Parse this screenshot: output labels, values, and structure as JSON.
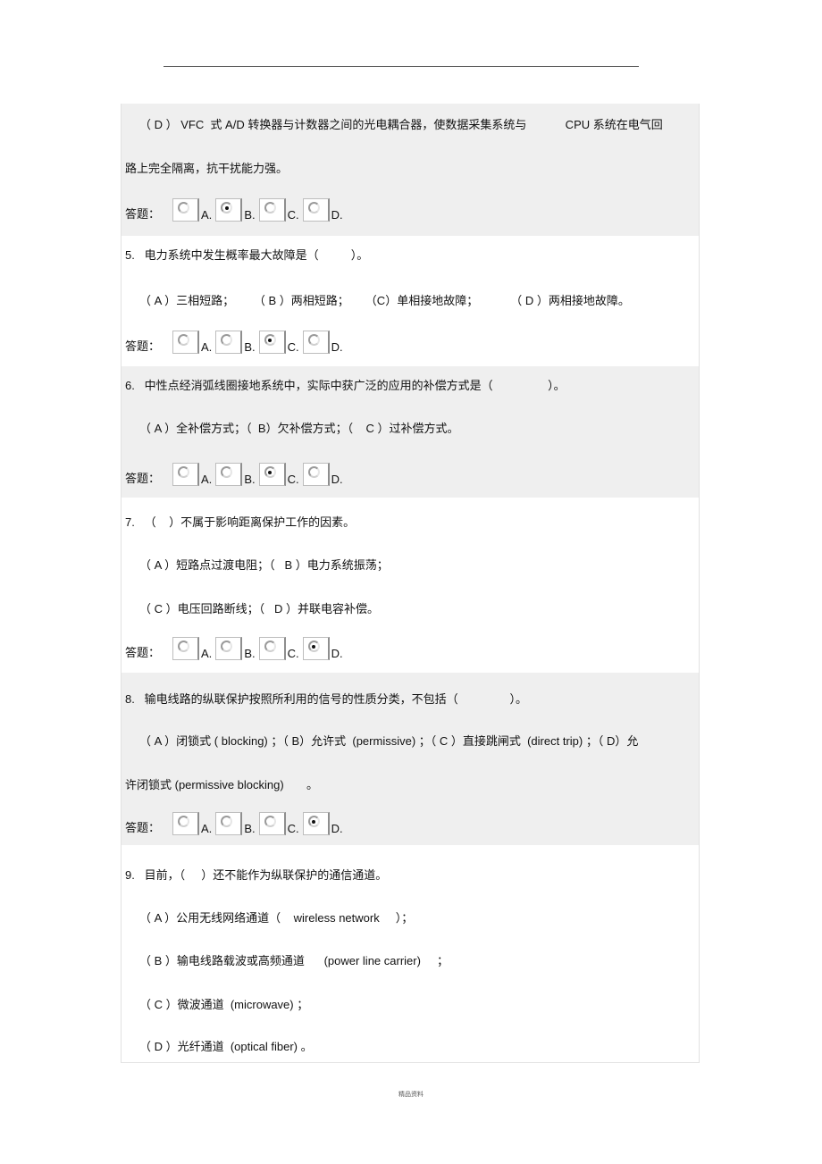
{
  "document": {
    "footer": "精品资料",
    "answer_label": "答题："
  },
  "q4_tail": {
    "option_d_line1": "（ D ） VFC  式 A/D 转换器与计数器之间的光电耦合器，使数据采集系统与            CPU 系统在电气回",
    "option_d_line2": "路上完全隔离，抗干扰能力强。",
    "options": [
      {
        "letter": "A.",
        "checked": false
      },
      {
        "letter": "B.",
        "checked": true
      },
      {
        "letter": "C.",
        "checked": false
      },
      {
        "letter": "D.",
        "checked": false
      }
    ]
  },
  "questions": [
    {
      "number": "5.",
      "stem": "5.   电力系统中发生概率最大故障是（          ）。",
      "choice_lines": [
        "（ A ）三相短路；      （ B ）两相短路；     （C）单相接地故障；          （ D ）两相接地故障。"
      ],
      "selected": "C",
      "options": [
        {
          "letter": "A.",
          "checked": false
        },
        {
          "letter": "B.",
          "checked": false
        },
        {
          "letter": "C.",
          "checked": true
        },
        {
          "letter": "D.",
          "checked": false
        }
      ]
    },
    {
      "number": "6.",
      "stem": "6.   中性点经消弧线圈接地系统中，实际中获广泛的应用的补偿方式是（                 ）。",
      "choice_lines": [
        "（ A ）全补偿方式；（  B）欠补偿方式；（    C ）过补偿方式。"
      ],
      "selected": "C",
      "options": [
        {
          "letter": "A.",
          "checked": false
        },
        {
          "letter": "B.",
          "checked": false
        },
        {
          "letter": "C.",
          "checked": true
        },
        {
          "letter": "D.",
          "checked": false
        }
      ]
    },
    {
      "number": "7.",
      "stem": "7.   （    ）不属于影响距离保护工作的因素。",
      "choice_lines": [
        "（ A ）短路点过渡电阻；（   B ）电力系统振荡；",
        "（ C ）电压回路断线；（   D ）并联电容补偿。"
      ],
      "selected": "D",
      "options": [
        {
          "letter": "A.",
          "checked": false
        },
        {
          "letter": "B.",
          "checked": false
        },
        {
          "letter": "C.",
          "checked": false
        },
        {
          "letter": "D.",
          "checked": true
        }
      ]
    },
    {
      "number": "8.",
      "stem": "8.   输电线路的纵联保护按照所利用的信号的性质分类，不包括（                ）。",
      "choice_lines": [
        "（ A ）闭锁式 ( blocking) ；（ B）允许式  (permissive) ；（ C ）直接跳闸式  (direct trip) ；（ D）允",
        "许闭锁式 (permissive blocking)       。"
      ],
      "selected": "D",
      "options": [
        {
          "letter": "A.",
          "checked": false
        },
        {
          "letter": "B.",
          "checked": false
        },
        {
          "letter": "C.",
          "checked": false
        },
        {
          "letter": "D.",
          "checked": true
        }
      ]
    },
    {
      "number": "9.",
      "stem": "9.   目前，（     ）还不能作为纵联保护的通信通道。",
      "choice_lines": [
        "（ A ）公用无线网络通道（    wireless network     ）；",
        "（ B ）输电线路载波或高频通道      (power line carrier)     ；",
        "（ C ）微波通道  (microwave) ；",
        "（ D ）光纤通道  (optical fiber) 。"
      ]
    }
  ]
}
